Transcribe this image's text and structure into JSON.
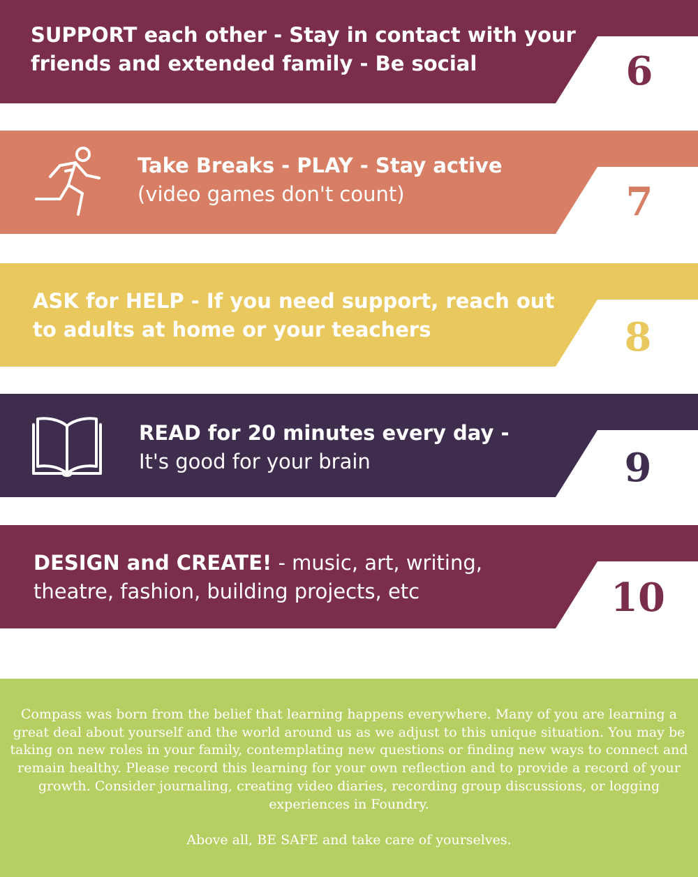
{
  "colors": {
    "plum": "#7a2e4c",
    "coral": "#d77e65",
    "gold": "#e9c95e",
    "navy": "#3e2d4d",
    "lime": "#b5cf63",
    "white": "#ffffff"
  },
  "items": [
    {
      "number": "6",
      "bold": "SUPPORT each other - Stay in contact with your",
      "regular": "",
      "line2_bold": "friends and extended family - Be social",
      "line2": "",
      "icon": ""
    },
    {
      "number": "7",
      "bold": "Take Breaks - PLAY - Stay active",
      "regular": "",
      "line2_bold": "",
      "line2": "(video games don't count)",
      "icon": "running-person-icon"
    },
    {
      "number": "8",
      "bold": "ASK for HELP - If you need support, reach out",
      "regular": "",
      "line2_bold": "to adults at home or your teachers",
      "line2": "",
      "icon": ""
    },
    {
      "number": "9",
      "bold": "READ for 20 minutes every day -",
      "regular": "",
      "line2_bold": "",
      "line2": "It's good for your brain",
      "icon": "open-book-icon"
    },
    {
      "number": "10",
      "bold": "DESIGN and CREATE!",
      "regular": " - music, art, writing,",
      "line2_bold": "",
      "line2": "theatre, fashion, building projects, etc",
      "icon": ""
    }
  ],
  "footer": {
    "paragraph": "Compass was born from the belief that learning happens everywhere.  Many of you are learning a great deal about yourself and the world around us as we adjust to this unique situation.  You may be taking on new roles in your family, contemplating new questions or finding new ways to connect and remain healthy.  Please record this learning for your own reflection and to provide a record of your growth.  Consider journaling, creating video diaries, recording group discussions, or logging experiences in Foundry.",
    "closing": "Above all, BE SAFE and take care of yourselves."
  }
}
